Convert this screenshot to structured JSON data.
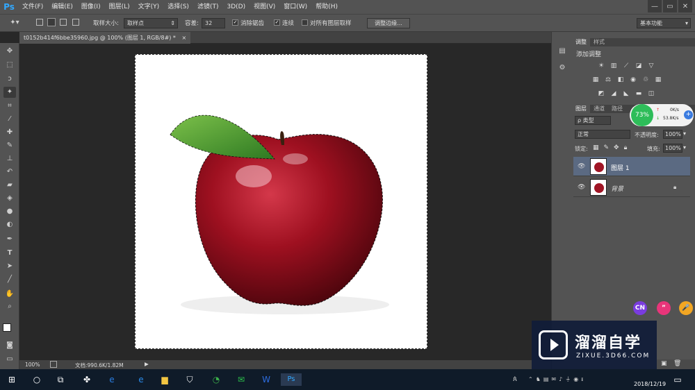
{
  "app": {
    "logo": "Ps"
  },
  "menu": [
    "文件(F)",
    "编辑(E)",
    "图像(I)",
    "图层(L)",
    "文字(Y)",
    "选择(S)",
    "滤镜(T)",
    "3D(D)",
    "视图(V)",
    "窗口(W)",
    "帮助(H)"
  ],
  "window_controls": [
    "—",
    "▭",
    "✕"
  ],
  "options": {
    "sample_size_label": "取样大小:",
    "sample_size_value": "取样点",
    "tolerance_label": "容差:",
    "tolerance_value": "32",
    "anti_alias_label": "消除锯齿",
    "contiguous_label": "连续",
    "sample_all_label": "对所有图层取样",
    "refine_button": "调整边缘...",
    "workspace": "基本功能"
  },
  "document": {
    "tab_title": "t0152b414f6bbe35960.jpg @ 100% (图层 1, RGB/8#) *",
    "close": "×"
  },
  "status": {
    "zoom": "100%",
    "doc_size": "文档:990.6K/1.82M"
  },
  "panels": {
    "adjust_tabs": [
      "调整",
      "样式"
    ],
    "adjust_title": "添加调整",
    "layer_tabs": [
      "图层",
      "通道",
      "路径"
    ],
    "filter_kind": "ρ 类型",
    "blend_mode": "正常",
    "opacity_label": "不透明度:",
    "opacity_value": "100%",
    "lock_label": "锁定:",
    "fill_label": "填充:",
    "fill_value": "100%",
    "layers": [
      {
        "name": "图层 1"
      },
      {
        "name": "背景"
      }
    ]
  },
  "net_widget": {
    "percent": "73%",
    "up": "0K/s",
    "down": "53.8K/s"
  },
  "float_buttons": [
    "CN",
    "”",
    "🎤"
  ],
  "watermark": {
    "title": "溜溜自学",
    "url": "ZIXUE.3D66.COM"
  },
  "taskbar": {
    "date": "2018/12/19"
  },
  "colors": {
    "accent": "#31a8ff",
    "layer_selected": "#5b6a82",
    "widget_green": "#2ebd59"
  }
}
